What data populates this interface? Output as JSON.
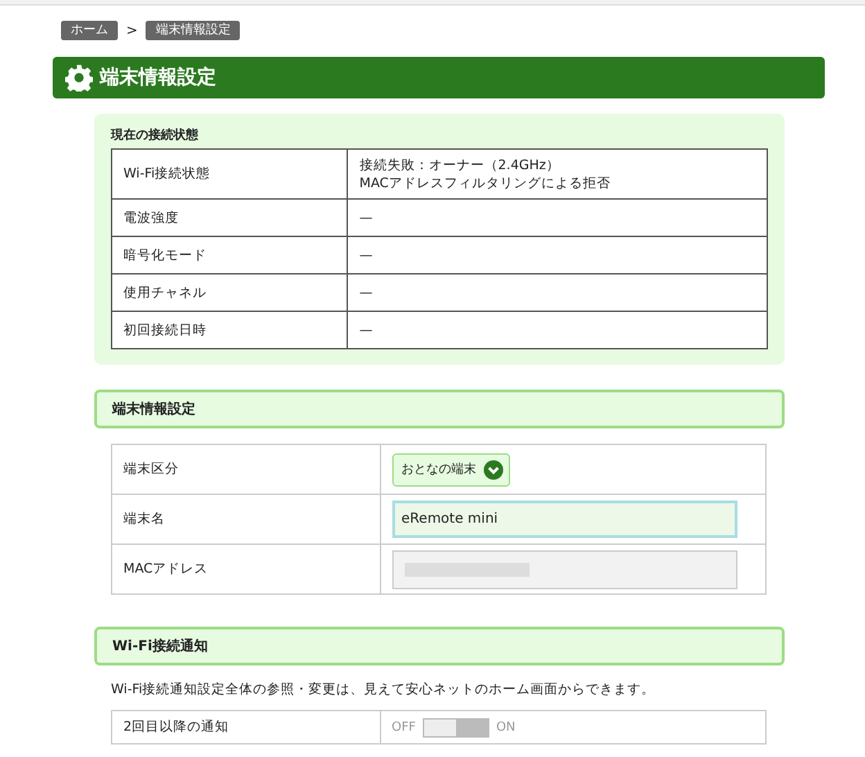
{
  "breadcrumb": [
    {
      "label": "ホーム"
    },
    {
      "label": "端末情報設定"
    }
  ],
  "breadcrumb_separator": ">",
  "page_title": "端末情報設定",
  "status": {
    "title": "現在の接続状態",
    "rows": [
      {
        "label": "Wi-Fi接続状態",
        "value": [
          "接続失敗：オーナー（2.4GHz）",
          "MACアドレスフィルタリングによる拒否"
        ]
      },
      {
        "label": "電波強度",
        "value": [
          "—"
        ]
      },
      {
        "label": "暗号化モード",
        "value": [
          "—"
        ]
      },
      {
        "label": "使用チャネル",
        "value": [
          "—"
        ]
      },
      {
        "label": "初回接続日時",
        "value": [
          "—"
        ]
      }
    ]
  },
  "device": {
    "title": "端末情報設定",
    "rows": [
      {
        "label": "端末区分",
        "kind": "select",
        "value": "おとなの端末"
      },
      {
        "label": "端末名",
        "kind": "input",
        "value": "eRemote mini"
      },
      {
        "label": "MACアドレス",
        "kind": "masked"
      }
    ]
  },
  "notify": {
    "title": "Wi-Fi接続通知",
    "note": "Wi-Fi接続通知設定全体の参照・変更は、見えて安心ネットのホーム画面からできます。",
    "rows": [
      {
        "label": "2回目以降の通知",
        "kind": "toggle",
        "on": false,
        "off_label": "OFF",
        "on_label": "ON"
      }
    ]
  }
}
